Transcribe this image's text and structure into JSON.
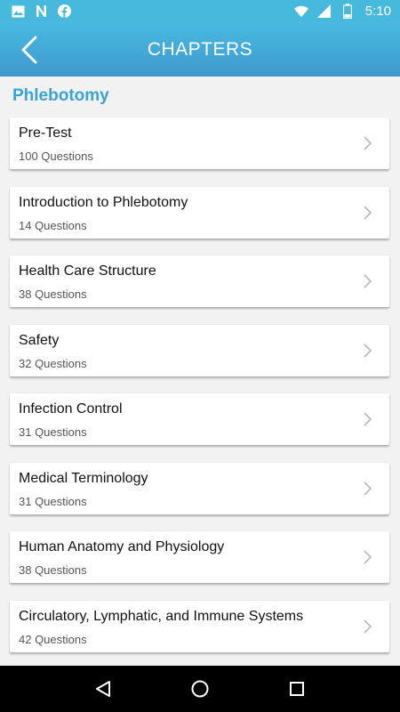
{
  "status_bar": {
    "time": "5:10",
    "icons": [
      "image-icon",
      "n-icon",
      "facebook-icon",
      "wifi-icon",
      "signal-icon",
      "battery-icon"
    ],
    "battery_level": "2"
  },
  "app_bar": {
    "title": "CHAPTERS",
    "back_icon": "chevron-left-icon"
  },
  "section": {
    "title": "Phlebotomy"
  },
  "chapters": [
    {
      "name": "Pre-Test",
      "count": "100 Questions"
    },
    {
      "name": "Introduction to Phlebotomy",
      "count": "14 Questions"
    },
    {
      "name": "Health Care Structure",
      "count": "38 Questions"
    },
    {
      "name": "Safety",
      "count": "32 Questions"
    },
    {
      "name": "Infection Control",
      "count": "31 Questions"
    },
    {
      "name": "Medical Terminology",
      "count": "31 Questions"
    },
    {
      "name": "Human Anatomy and Physiology",
      "count": "38 Questions"
    },
    {
      "name": "Circulatory, Lymphatic, and Immune Systems",
      "count": "42 Questions"
    }
  ],
  "nav_bar": {
    "icons": [
      "back-triangle-icon",
      "home-circle-icon",
      "recents-square-icon"
    ]
  },
  "colors": {
    "accent": "#3aa3d4",
    "app_bar_top": "#48bbdf",
    "app_bar_bottom": "#3f99cf"
  }
}
